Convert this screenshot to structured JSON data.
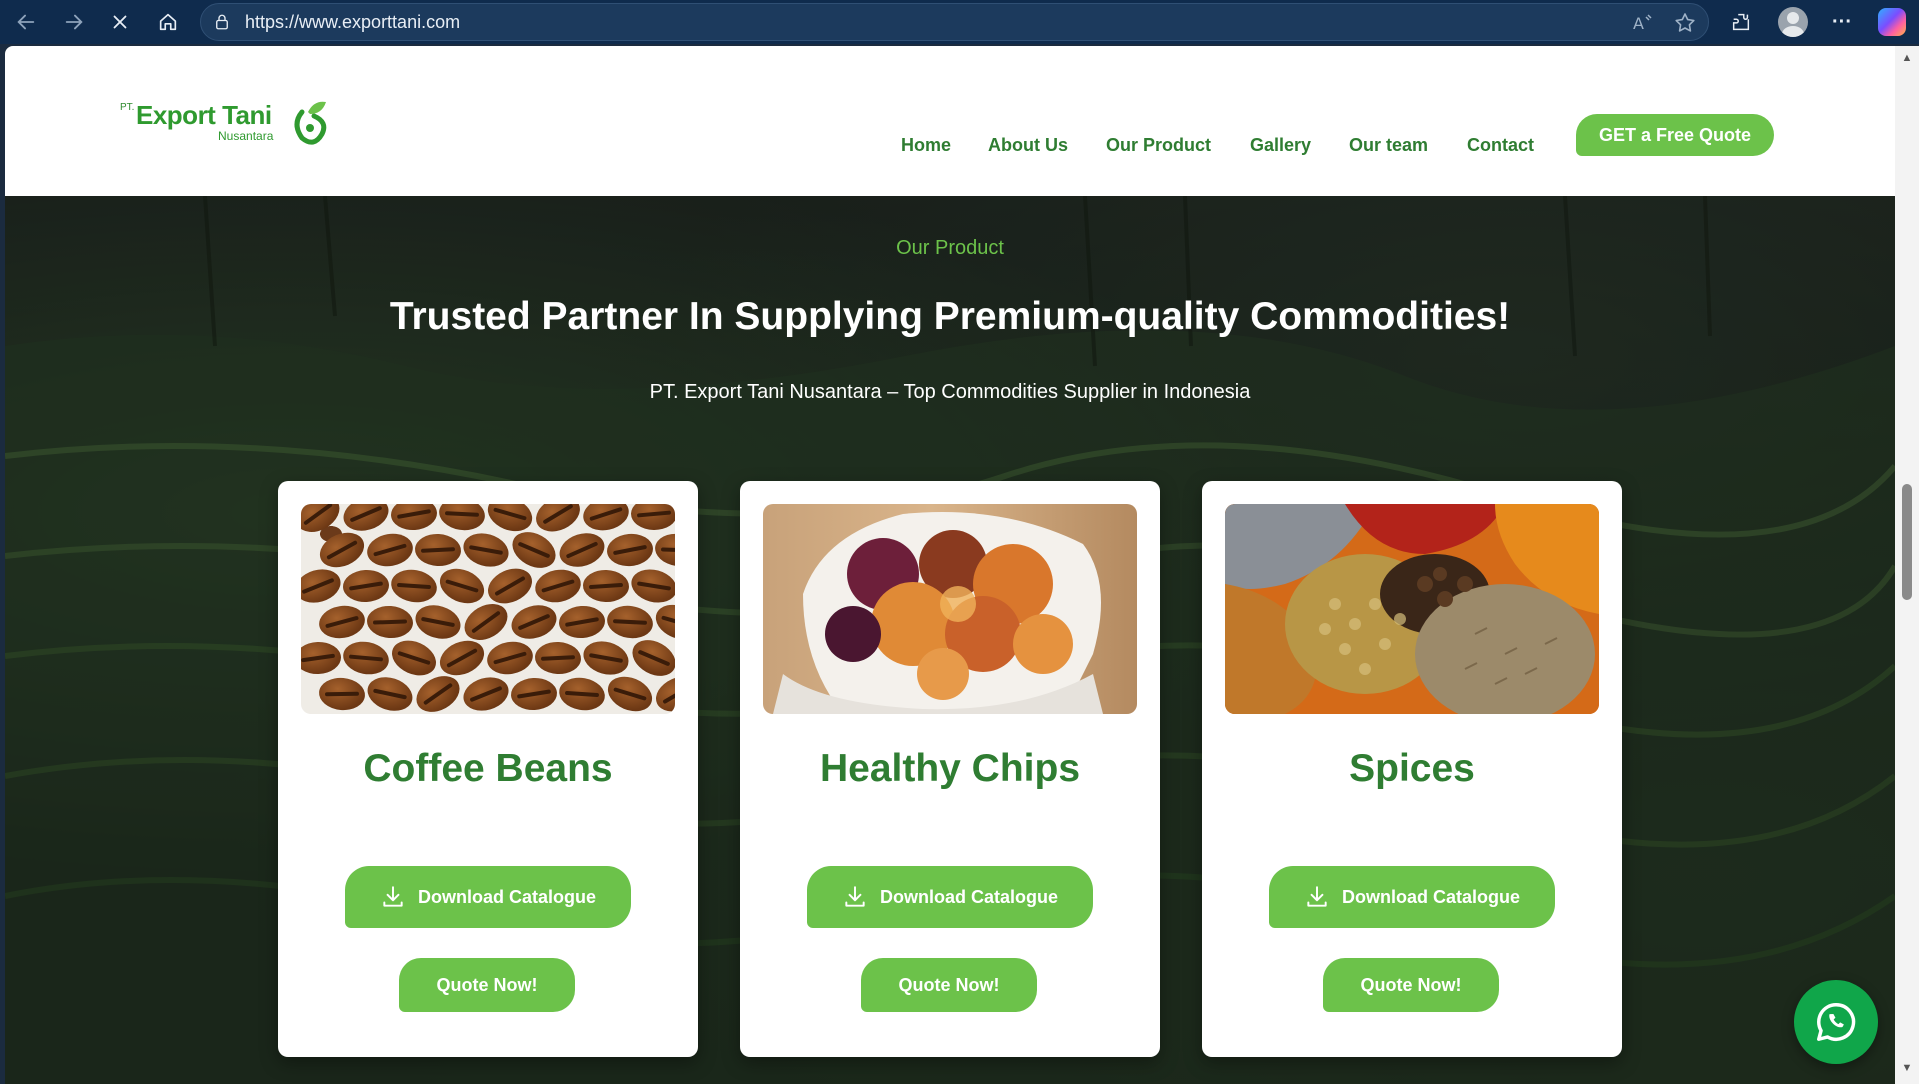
{
  "browser": {
    "url": "https://www.exporttani.com"
  },
  "site": {
    "logo": {
      "prefix": "PT.",
      "name": "Export Tani",
      "sub": "Nusantara"
    },
    "nav": [
      {
        "label": "Home"
      },
      {
        "label": "About Us"
      },
      {
        "label": "Our Product"
      },
      {
        "label": "Gallery"
      },
      {
        "label": "Our team"
      },
      {
        "label": "Contact"
      }
    ],
    "cta_label": "GET a Free Quote"
  },
  "hero": {
    "eyebrow": "Our Product",
    "title": "Trusted Partner In Supplying Premium-quality Commodities!",
    "subtitle": "PT. Export Tani Nusantara – Top Commodities Supplier in Indonesia"
  },
  "products": [
    {
      "title": "Coffee Beans",
      "download_label": "Download Catalogue",
      "quote_label": "Quote Now!"
    },
    {
      "title": "Healthy Chips",
      "download_label": "Download Catalogue",
      "quote_label": "Quote Now!"
    },
    {
      "title": "Spices",
      "download_label": "Download Catalogue",
      "quote_label": "Quote Now!"
    }
  ],
  "colors": {
    "brand_green": "#6cc24a",
    "dark_green": "#2f7d32",
    "browser_chrome": "#0f2b4d",
    "whatsapp": "#10a64a"
  },
  "icons": [
    "back-icon",
    "forward-icon",
    "stop-icon",
    "home-icon",
    "lock-icon",
    "read-aloud-icon",
    "favorite-star-icon",
    "extensions-icon",
    "profile-icon",
    "more-icon",
    "copilot-icon",
    "download-icon",
    "whatsapp-icon"
  ]
}
